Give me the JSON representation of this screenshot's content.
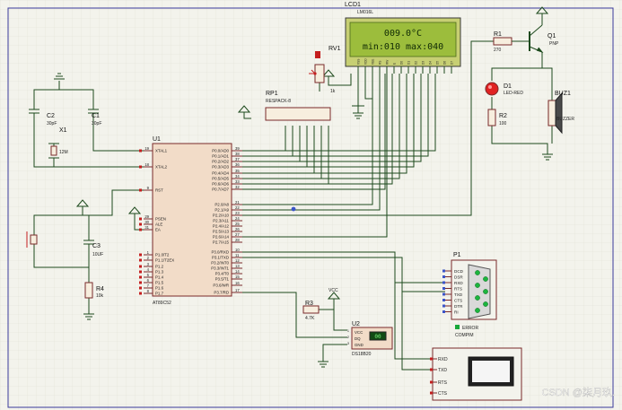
{
  "lcd": {
    "ref": "LCD1",
    "part": "LM016L",
    "line1": "009.0°C",
    "line2": "min:010  max:040",
    "pins": [
      "VSS",
      "VDD",
      "VEE",
      "RS",
      "RW",
      "E",
      "D0",
      "D1",
      "D2",
      "D3",
      "D4",
      "D5",
      "D6",
      "D7"
    ]
  },
  "rv1": {
    "ref": "RV1",
    "value": "1k"
  },
  "rp1": {
    "ref": "RP1",
    "part": "RESPACK-8"
  },
  "c1": {
    "ref": "C1",
    "value": "30pF"
  },
  "c2": {
    "ref": "C2",
    "value": "30pF"
  },
  "x1": {
    "ref": "X1",
    "value": "12M"
  },
  "c3": {
    "ref": "C3",
    "value": "10UF"
  },
  "r4": {
    "ref": "R4",
    "value": "10k"
  },
  "r1": {
    "ref": "R1",
    "value": "270"
  },
  "r2": {
    "ref": "R2",
    "value": "100"
  },
  "r3": {
    "ref": "R3",
    "value": "4.7K"
  },
  "q1": {
    "ref": "Q1",
    "part": "PNP"
  },
  "d1": {
    "ref": "D1",
    "part": "LED-RED"
  },
  "buz": {
    "ref": "BUZ1",
    "part": "BUZZER"
  },
  "vcc": "VCC",
  "u1": {
    "ref": "U1",
    "part": "AT89C52",
    "left_pins": [
      {
        "num": "19",
        "name": "XTAL1"
      },
      {
        "num": "18",
        "name": "XTAL2"
      },
      {
        "num": "9",
        "name": "RST"
      },
      {
        "num": "29",
        "name": "PSEN"
      },
      {
        "num": "30",
        "name": "ALE"
      },
      {
        "num": "31",
        "name": "EA"
      },
      {
        "num": "1",
        "name": "P1.0/T2"
      },
      {
        "num": "2",
        "name": "P1.1/T2EX"
      },
      {
        "num": "3",
        "name": "P1.2"
      },
      {
        "num": "4",
        "name": "P1.3"
      },
      {
        "num": "5",
        "name": "P1.4"
      },
      {
        "num": "6",
        "name": "P1.5"
      },
      {
        "num": "7",
        "name": "P1.6"
      },
      {
        "num": "8",
        "name": "P1.7"
      }
    ],
    "right_pins": [
      {
        "num": "39",
        "name": "P0.0/AD0"
      },
      {
        "num": "38",
        "name": "P0.1/AD1"
      },
      {
        "num": "37",
        "name": "P0.2/AD2"
      },
      {
        "num": "36",
        "name": "P0.3/AD3"
      },
      {
        "num": "35",
        "name": "P0.4/AD4"
      },
      {
        "num": "34",
        "name": "P0.5/AD5"
      },
      {
        "num": "33",
        "name": "P0.6/AD6"
      },
      {
        "num": "32",
        "name": "P0.7/AD7"
      },
      {
        "num": "21",
        "name": "P2.0/A8"
      },
      {
        "num": "22",
        "name": "P2.1/A9"
      },
      {
        "num": "23",
        "name": "P2.2/A10"
      },
      {
        "num": "24",
        "name": "P2.3/A11"
      },
      {
        "num": "25",
        "name": "P2.4/A12"
      },
      {
        "num": "26",
        "name": "P2.5/A13"
      },
      {
        "num": "27",
        "name": "P2.6/A14"
      },
      {
        "num": "28",
        "name": "P2.7/A15"
      },
      {
        "num": "10",
        "name": "P3.0/RXD"
      },
      {
        "num": "11",
        "name": "P3.1/TXD"
      },
      {
        "num": "12",
        "name": "P3.2/INT0"
      },
      {
        "num": "13",
        "name": "P3.3/INT1"
      },
      {
        "num": "14",
        "name": "P3.4/T0"
      },
      {
        "num": "15",
        "name": "P3.5/T1"
      },
      {
        "num": "16",
        "name": "P3.6/WR"
      },
      {
        "num": "17",
        "name": "P3.7/RD"
      }
    ]
  },
  "u2": {
    "ref": "U2",
    "part": "DS18B20",
    "pins": [
      "VCC",
      "DQ",
      "GND"
    ],
    "pin_nums": [
      "1",
      "2",
      "3"
    ],
    "readout": "00"
  },
  "p1": {
    "ref": "P1",
    "part": "COMPIM",
    "pins": [
      "DCD",
      "DSR",
      "RXD",
      "RTS",
      "TXD",
      "CTS",
      "DTR",
      "RI"
    ],
    "status": "ERROR"
  },
  "vterm": {
    "pins": [
      "RXD",
      "TXD",
      "RTS",
      "CTS"
    ]
  },
  "watermark": "CSDN @柒月玖."
}
